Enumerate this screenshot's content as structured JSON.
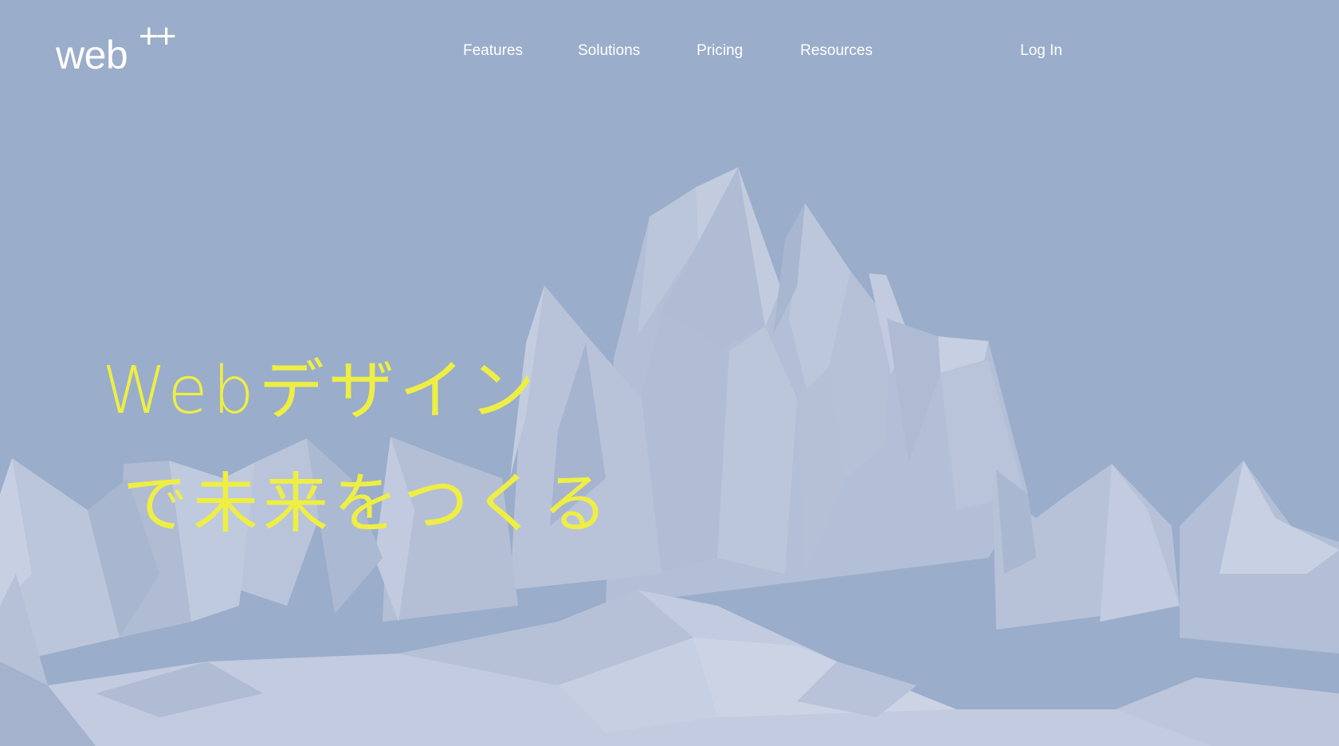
{
  "logo": {
    "word": "web",
    "superscript": "++"
  },
  "nav": {
    "items": [
      {
        "label": "Features"
      },
      {
        "label": "Solutions"
      },
      {
        "label": "Pricing"
      },
      {
        "label": "Resources"
      }
    ],
    "login_label": "Log In"
  },
  "hero": {
    "line1": "Webデザイン",
    "line2": "で未来をつくる"
  },
  "colors": {
    "background": "#9aadca",
    "hero_text": "#eeee44",
    "nav_text": "#ffffff"
  }
}
